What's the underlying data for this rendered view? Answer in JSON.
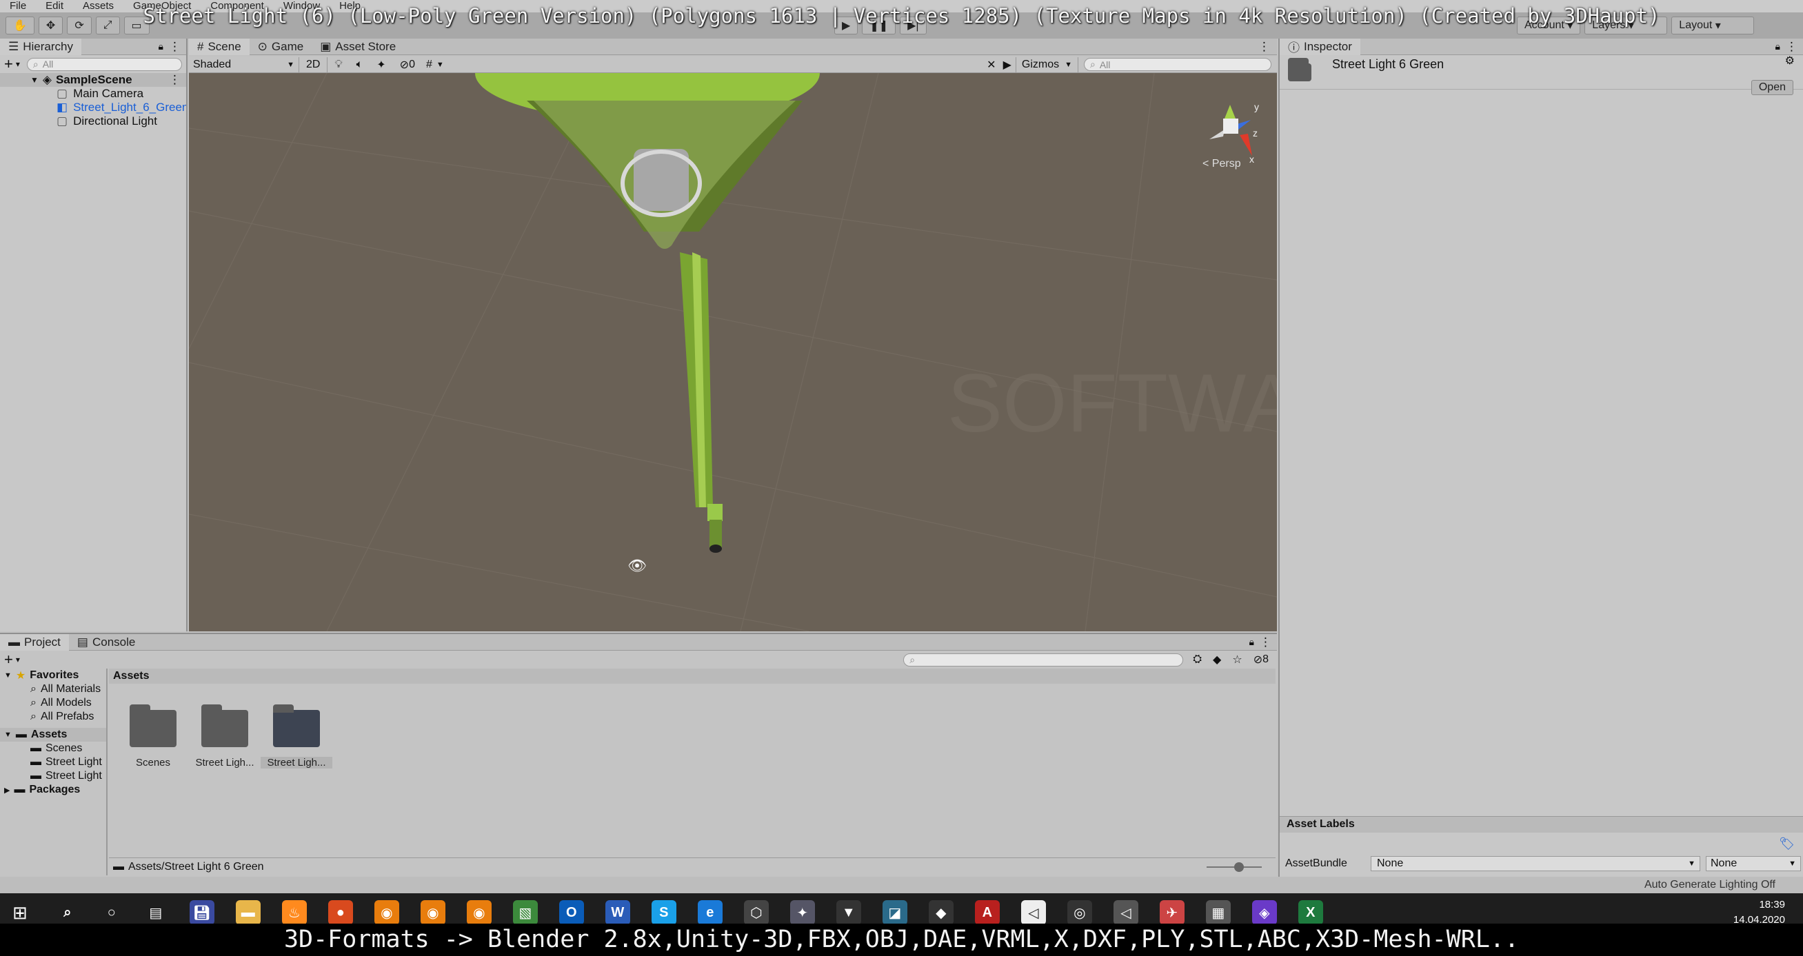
{
  "menu": [
    "File",
    "Edit",
    "Assets",
    "GameObject",
    "Component",
    "Window",
    "Help"
  ],
  "video_title": "Street Light (6) (Low-Poly Green Version) (Polygons 1613 | Vertices 1285) (Texture Maps in 4k Resolution) (Created by 3DHaupt)",
  "toolbar": {
    "layers_label": "Layers",
    "layout_label": "Layout",
    "account_label": "Account"
  },
  "hierarchy": {
    "tab_label": "Hierarchy",
    "search_placeholder": "All",
    "scene_name": "SampleScene",
    "items": [
      {
        "label": "Main Camera",
        "selected": false
      },
      {
        "label": "Street_Light_6_Green",
        "selected": true
      },
      {
        "label": "Directional Light",
        "selected": false
      }
    ]
  },
  "scene_tabs": [
    "Scene",
    "Game",
    "Asset Store"
  ],
  "scene_toolbar": {
    "shading": "Shaded",
    "mode_2d": "2D",
    "hidden_count": "0",
    "gizmos": "Gizmos",
    "search_placeholder": "All"
  },
  "gizmo": {
    "persp_label": "< Persp",
    "axis_y": "y",
    "axis_z": "z",
    "axis_x": "x"
  },
  "inspector": {
    "tab_label": "Inspector",
    "asset_name": "Street Light 6 Green",
    "open_button": "Open",
    "asset_labels": "Asset Labels",
    "assetbundle_label": "AssetBundle",
    "assetbundle_value": "None",
    "assetbundle_variant": "None"
  },
  "project": {
    "tabs": [
      "Project",
      "Console"
    ],
    "visible_count": "8",
    "favorites_label": "Favorites",
    "favorites": [
      "All Materials",
      "All Models",
      "All Prefabs"
    ],
    "assets_label": "Assets",
    "asset_folders": [
      "Scenes",
      "Street Light",
      "Street Light"
    ],
    "packages_label": "Packages",
    "breadcrumb": "Assets",
    "grid_items": [
      {
        "label": "Scenes",
        "selected": false
      },
      {
        "label": "Street Ligh...",
        "selected": false
      },
      {
        "label": "Street Ligh...",
        "selected": true
      }
    ],
    "path": "Assets/Street Light 6 Green"
  },
  "status": {
    "lighting": "Auto Generate Lighting Off"
  },
  "taskbar": {
    "time": "18:39",
    "date": "14.04.2020"
  },
  "watermark": "SOFTWARE SERVICE JOHN",
  "bottom_caption": "3D-Formats -> Blender 2.8x,Unity-3D,FBX,OBJ,DAE,VRML,X,DXF,PLY,STL,ABC,X3D-Mesh-WRL..",
  "colors": {
    "scene_bg": "#6a6156",
    "lamp_green": "#8fbc3a",
    "selection_blue": "#1a5fd6"
  }
}
